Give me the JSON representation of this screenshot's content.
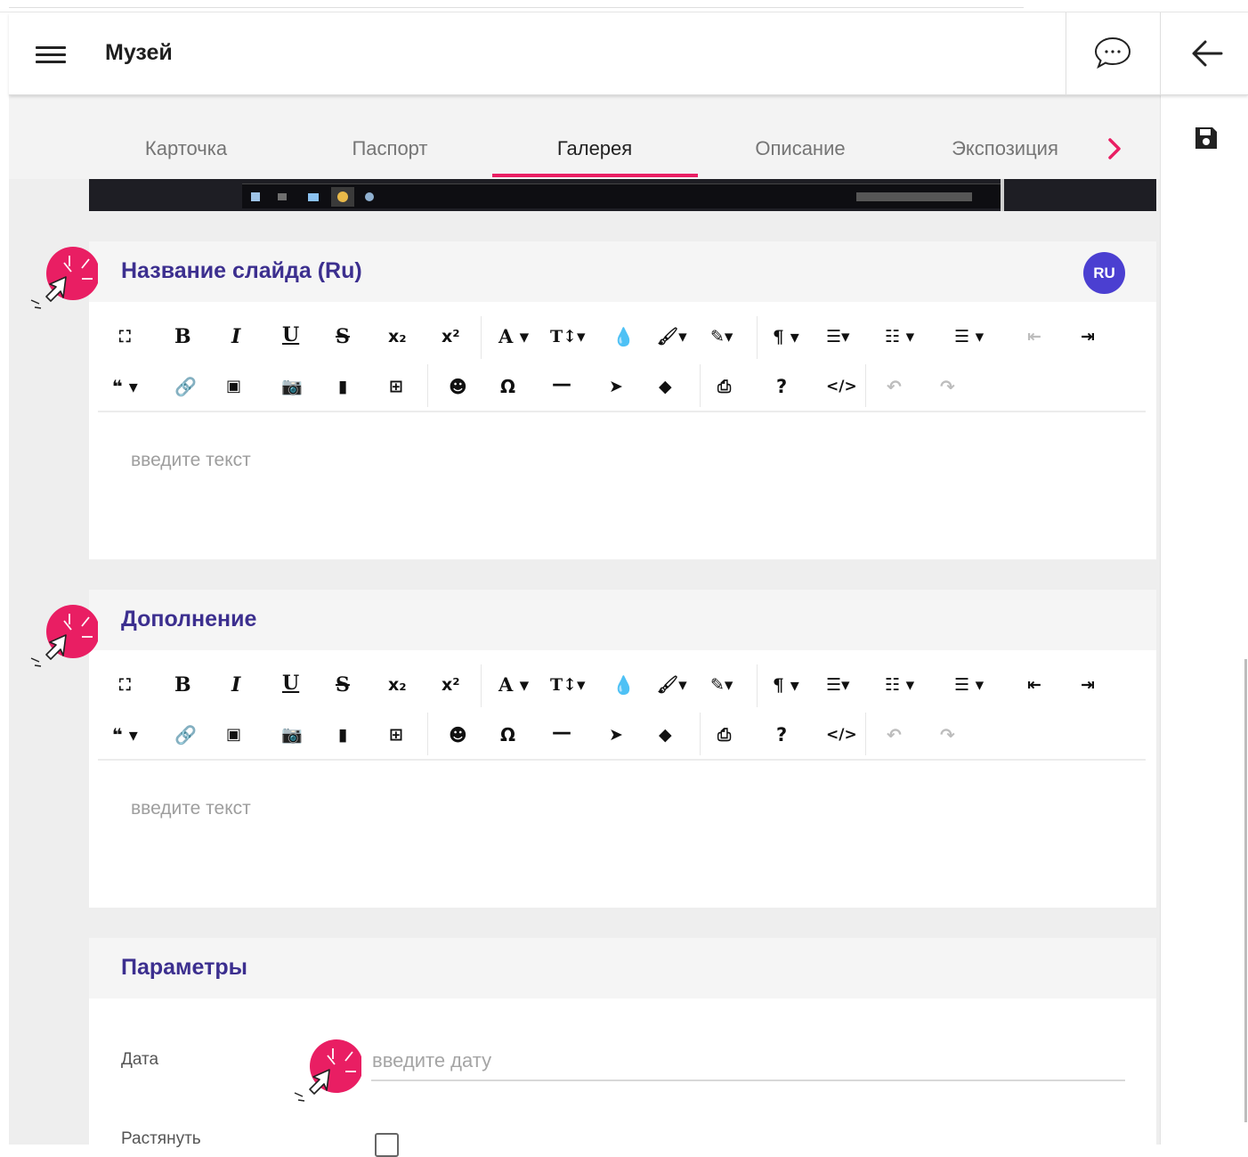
{
  "header": {
    "title": "Музей"
  },
  "tabs": [
    {
      "label": "Карточка"
    },
    {
      "label": "Паспорт"
    },
    {
      "label": "Галерея"
    },
    {
      "label": "Описание"
    },
    {
      "label": "Экспозиция"
    }
  ],
  "active_tab": "Галерея",
  "colors": {
    "accent": "#e91e63",
    "title": "#3c2f8f",
    "badge": "#4b3fd1"
  },
  "slide_title_section": {
    "title": "Название слайда (Ru)",
    "lang_badge": "RU",
    "placeholder": "введите текст"
  },
  "addition_section": {
    "title": "Дополнение",
    "placeholder": "введите текст"
  },
  "params_section": {
    "title": "Параметры",
    "date_label": "Дата",
    "date_placeholder": "введите дату",
    "stretch_label": "Растянуть",
    "stretch_checked": false
  },
  "toolbar": {
    "bold": "B",
    "italic": "I",
    "underline": "U",
    "strikethrough": "S",
    "subscript": "x₂",
    "superscript": "x²",
    "font_family": "A ▾",
    "font_size": "T↕▾",
    "paragraph": "¶ ▾",
    "quote": "❝ ▾",
    "special_char": "Ω",
    "help": "?",
    "code": "</>"
  }
}
